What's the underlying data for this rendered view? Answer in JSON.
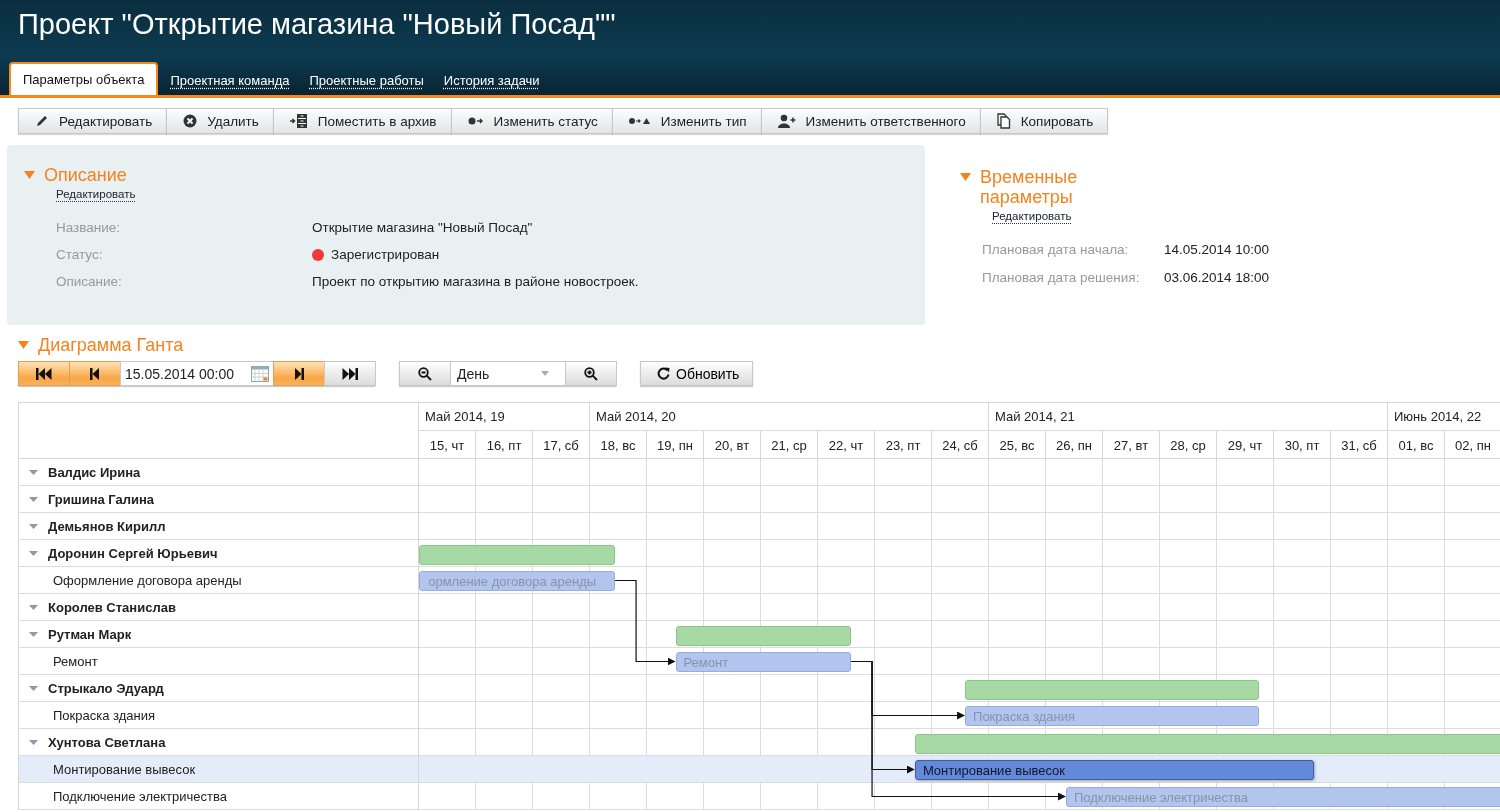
{
  "title": "Проект \"Открытие магазина \"Новый Посад\"\"",
  "tabs": [
    {
      "label": "Параметры объекта",
      "selected": true
    },
    {
      "label": "Проектная команда",
      "selected": false
    },
    {
      "label": "Проектные работы",
      "selected": false
    },
    {
      "label": "История задачи",
      "selected": false
    }
  ],
  "toolbar": [
    {
      "label": "Редактировать",
      "kind": "pencil"
    },
    {
      "label": "Удалить",
      "kind": "delete"
    },
    {
      "label": "Поместить в архив",
      "kind": "archive"
    },
    {
      "label": "Изменить статус",
      "kind": "status"
    },
    {
      "label": "Изменить тип",
      "kind": "type"
    },
    {
      "label": "Изменить ответственного",
      "kind": "person"
    },
    {
      "label": "Копировать",
      "kind": "copy"
    }
  ],
  "description": {
    "heading": "Описание",
    "edit_link": "Редактировать",
    "expanded": true,
    "fields": [
      {
        "label": "Название:",
        "value": "Открытие магазина \"Новый Посад\""
      },
      {
        "label": "Статус:",
        "value": "Зарегистрирован",
        "color": "#f03a3a"
      },
      {
        "label": "Описание:",
        "value": "Проект по открытию магазина в районе новостроек."
      }
    ]
  },
  "time_params": {
    "heading": "Временные параметры",
    "edit_link": "Редактировать",
    "expanded": true,
    "fields": [
      {
        "label": "Плановая дата начала:",
        "value": "14.05.2014 10:00"
      },
      {
        "label": "Плановая дата решения:",
        "value": "03.06.2014 18:00"
      }
    ]
  },
  "gantt": {
    "heading": "Диаграмма Ганта",
    "expanded": true,
    "nav": [
      {
        "kind": "first",
        "highlighted": true
      },
      {
        "kind": "prev",
        "highlighted": true
      },
      {
        "kind": "date",
        "value": "15.05.2014 00:00"
      },
      {
        "kind": "next",
        "highlighted": true
      },
      {
        "kind": "last",
        "highlighted": false
      }
    ],
    "scale": "День",
    "refresh": "Обновить",
    "months": [
      "Май 2014, 19",
      "Май 2014, 20",
      "Май 2014, 21",
      "Июнь 2014, 22"
    ],
    "days": [
      "15, чт",
      "16, пт",
      "17, сб",
      "18, вс",
      "19, пн",
      "20, вт",
      "21, ср",
      "22, чт",
      "23, пт",
      "24, сб",
      "25, вс",
      "26, пн",
      "27, вт",
      "28, ср",
      "29, чт",
      "30, пт",
      "31, сб",
      "01, вс",
      "02, пн"
    ],
    "people": [
      {
        "name": "Валдис Ирина",
        "expanded": true
      },
      {
        "name": "Гришина Галина",
        "expanded": true
      },
      {
        "name": "Демьянов Кирилл",
        "expanded": true
      },
      {
        "name": "Доронин Сергей Юрьевич",
        "expanded": true,
        "summary_bar": true,
        "children": [
          {
            "name": "Оформление договора аренды",
            "selected": false,
            "bar_label": "ормление договора аренды"
          }
        ]
      },
      {
        "name": "Королев Станислав",
        "expanded": true
      },
      {
        "name": "Рутман Марк",
        "expanded": true,
        "summary_bar": true,
        "children": [
          {
            "name": "Ремонт",
            "selected": false,
            "bar_label": "Ремонт"
          }
        ]
      },
      {
        "name": "Стрыкало Эдуард",
        "expanded": true,
        "summary_bar": true,
        "children": [
          {
            "name": "Покраска здания",
            "selected": false,
            "bar_label": "Покраска здания"
          }
        ]
      },
      {
        "name": "Хунтова Светлана",
        "expanded": true,
        "summary_bar": true,
        "children": [
          {
            "name": "Монтирование вывесок",
            "selected": true,
            "bar_label": "Монтирование вывесок"
          },
          {
            "name": "Подключение электричества",
            "selected": false,
            "bar_label": "Подключение электричества"
          }
        ]
      }
    ]
  }
}
